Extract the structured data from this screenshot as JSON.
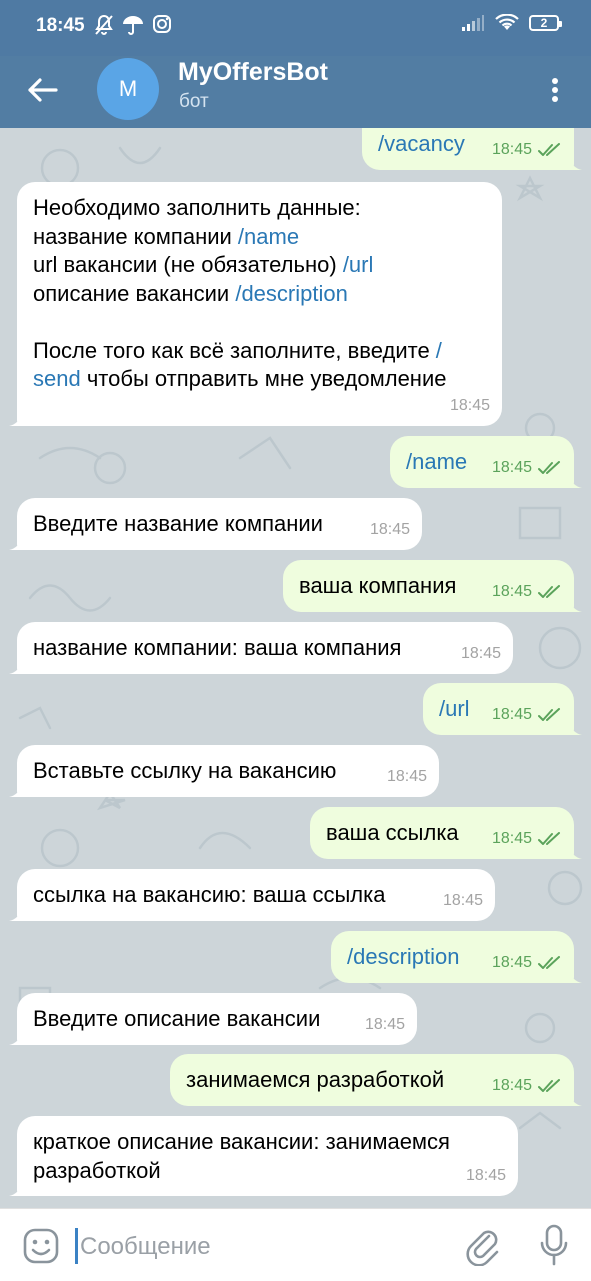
{
  "status_bar": {
    "time": "18:45",
    "battery": "2",
    "left_icons": [
      "mute-bell-icon",
      "umbrella-icon",
      "instagram-icon"
    ],
    "right_icons": [
      "signal-icon",
      "wifi-icon",
      "battery-icon"
    ]
  },
  "header": {
    "bot_name": "MyOffersBot",
    "subtitle": "бот",
    "avatar_letter": "M"
  },
  "messages": [
    {
      "dir": "out",
      "text": "/vacancy",
      "time": "18:45"
    },
    {
      "dir": "in",
      "lines": [
        [
          {
            "t": "Необходимо заполнить данные:"
          }
        ],
        [
          {
            "t": "название компании "
          },
          {
            "t": "/name",
            "cmd": true
          }
        ],
        [
          {
            "t": "url вакансии (не обязательно) "
          },
          {
            "t": "/url",
            "cmd": true
          }
        ],
        [
          {
            "t": "описание вакансии "
          },
          {
            "t": "/description",
            "cmd": true
          }
        ],
        [
          {
            "t": ""
          }
        ],
        [
          {
            "t": "После того как всё заполните, введите "
          },
          {
            "t": "/",
            "cmd": true
          }
        ],
        [
          {
            "t": "send",
            "cmd": true
          },
          {
            "t": " чтобы отправить мне уведомление"
          }
        ]
      ],
      "time": "18:45"
    },
    {
      "dir": "out",
      "text": "/name",
      "time": "18:45"
    },
    {
      "dir": "in",
      "text": "Введите название компании",
      "time": "18:45"
    },
    {
      "dir": "out",
      "text": "ваша компания",
      "time": "18:45"
    },
    {
      "dir": "in",
      "text": "название компании: ваша компания",
      "time": "18:45"
    },
    {
      "dir": "out",
      "text": "/url",
      "time": "18:45"
    },
    {
      "dir": "in",
      "text": "Вставьте ссылку на вакансию",
      "time": "18:45"
    },
    {
      "dir": "out",
      "text": "ваша ссылка",
      "time": "18:45"
    },
    {
      "dir": "in",
      "text": "ссылка на вакансию: ваша ссылка",
      "time": "18:45"
    },
    {
      "dir": "out",
      "text": "/description",
      "time": "18:45"
    },
    {
      "dir": "in",
      "text": "Введите описание вакансии",
      "time": "18:45"
    },
    {
      "dir": "out",
      "text": "занимаемся разработкой",
      "time": "18:45"
    },
    {
      "dir": "in",
      "lines": [
        [
          {
            "t": "краткое описание вакансии: занимаемся"
          }
        ],
        [
          {
            "t": "разработкой"
          }
        ]
      ],
      "time": "18:45"
    }
  ],
  "input": {
    "placeholder": "Сообщение"
  },
  "colors": {
    "header_bg": "#527da3",
    "status_bg": "#4f7aa3",
    "incoming_bubble": "#ffffff",
    "outgoing_bubble": "#effdde",
    "command_link": "#2a78b5",
    "read_checks": "#5ba35b",
    "avatar": "#5aa5e6"
  }
}
